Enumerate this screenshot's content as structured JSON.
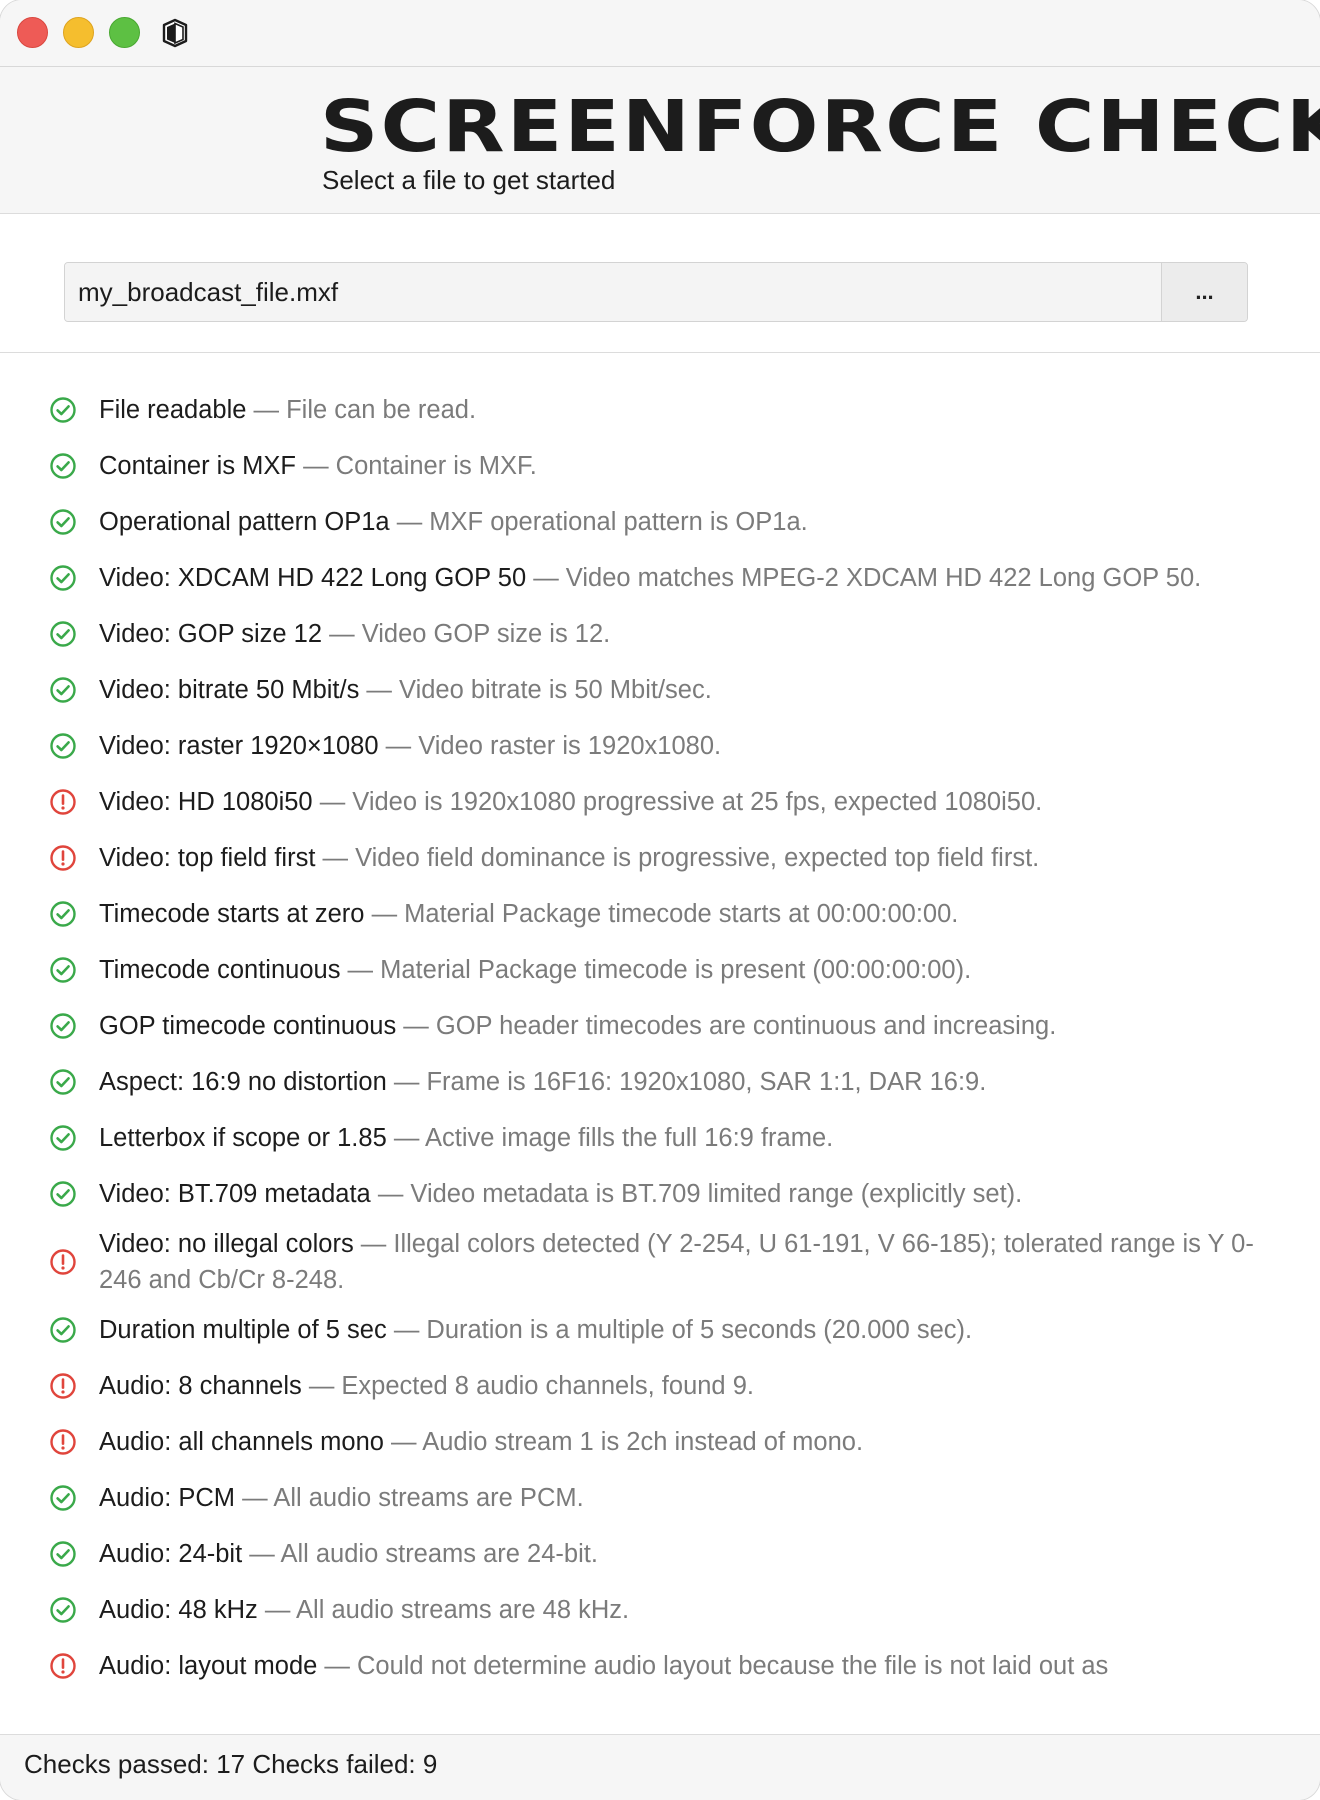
{
  "header": {
    "title": "SCREENFORCE CHECKER",
    "subtitle": "Select a file to get started"
  },
  "file": {
    "value": "my_broadcast_file.mxf",
    "browse_label": "..."
  },
  "colors": {
    "pass": "#3aa94a",
    "fail": "#e0453c",
    "detail": "#7b7b7b"
  },
  "checks": [
    {
      "status": "pass",
      "label": "File readable",
      "separator": " — ",
      "detail": "File can be read."
    },
    {
      "status": "pass",
      "label": "Container is MXF",
      "separator": " — ",
      "detail": "Container is MXF."
    },
    {
      "status": "pass",
      "label": "Operational pattern OP1a",
      "separator": " — ",
      "detail": "MXF operational pattern is OP1a."
    },
    {
      "status": "pass",
      "label": "Video: XDCAM HD 422 Long GOP 50",
      "separator": " — ",
      "detail": "Video matches MPEG-2 XDCAM HD 422 Long GOP 50."
    },
    {
      "status": "pass",
      "label": "Video: GOP size 12",
      "separator": " — ",
      "detail": "Video GOP size is 12."
    },
    {
      "status": "pass",
      "label": "Video: bitrate 50 Mbit/s",
      "separator": " — ",
      "detail": "Video bitrate is 50 Mbit/sec."
    },
    {
      "status": "pass",
      "label": "Video: raster 1920×1080",
      "separator": " — ",
      "detail": "Video raster is 1920x1080."
    },
    {
      "status": "fail",
      "label": "Video: HD 1080i50",
      "separator": " — ",
      "detail": "Video is 1920x1080 progressive at 25 fps, expected 1080i50."
    },
    {
      "status": "fail",
      "label": "Video: top field first",
      "separator": " — ",
      "detail": "Video field dominance is progressive, expected top field first."
    },
    {
      "status": "pass",
      "label": "Timecode starts at zero",
      "separator": " — ",
      "detail": "Material Package timecode starts at 00:00:00:00."
    },
    {
      "status": "pass",
      "label": "Timecode continuous",
      "separator": " — ",
      "detail": "Material Package timecode is present (00:00:00:00)."
    },
    {
      "status": "pass",
      "label": "GOP timecode continuous",
      "separator": " — ",
      "detail": "GOP header timecodes are continuous and increasing."
    },
    {
      "status": "pass",
      "label": "Aspect: 16:9 no distortion",
      "separator": " — ",
      "detail": "Frame is 16F16: 1920x1080, SAR 1:1, DAR 16:9."
    },
    {
      "status": "pass",
      "label": "Letterbox if scope or 1.85",
      "separator": " — ",
      "detail": "Active image fills the full 16:9 frame."
    },
    {
      "status": "pass",
      "label": "Video: BT.709 metadata",
      "separator": " — ",
      "detail": "Video metadata is BT.709 limited range (explicitly set)."
    },
    {
      "status": "fail",
      "label": "Video: no illegal colors",
      "separator": " — ",
      "detail": "Illegal colors detected (Y 2-254, U 61-191, V 66-185); tolerated range is Y 0-246 and Cb/Cr 8-248."
    },
    {
      "status": "pass",
      "label": "Duration multiple of 5 sec",
      "separator": " — ",
      "detail": "Duration is a multiple of 5 seconds (20.000 sec)."
    },
    {
      "status": "fail",
      "label": "Audio: 8 channels",
      "separator": " — ",
      "detail": "Expected 8 audio channels, found 9."
    },
    {
      "status": "fail",
      "label": "Audio: all channels mono",
      "separator": " — ",
      "detail": "Audio stream 1 is 2ch instead of mono."
    },
    {
      "status": "pass",
      "label": "Audio: PCM",
      "separator": " — ",
      "detail": "All audio streams are PCM."
    },
    {
      "status": "pass",
      "label": "Audio: 24-bit",
      "separator": " — ",
      "detail": "All audio streams are 24-bit."
    },
    {
      "status": "pass",
      "label": "Audio: 48 kHz",
      "separator": " — ",
      "detail": "All audio streams are 48 kHz."
    },
    {
      "status": "fail",
      "label": "Audio: layout mode",
      "separator": " — ",
      "detail": "Could not determine audio layout because the file is not laid out as"
    }
  ],
  "status": {
    "text": "Checks passed: 17 Checks failed: 9"
  }
}
